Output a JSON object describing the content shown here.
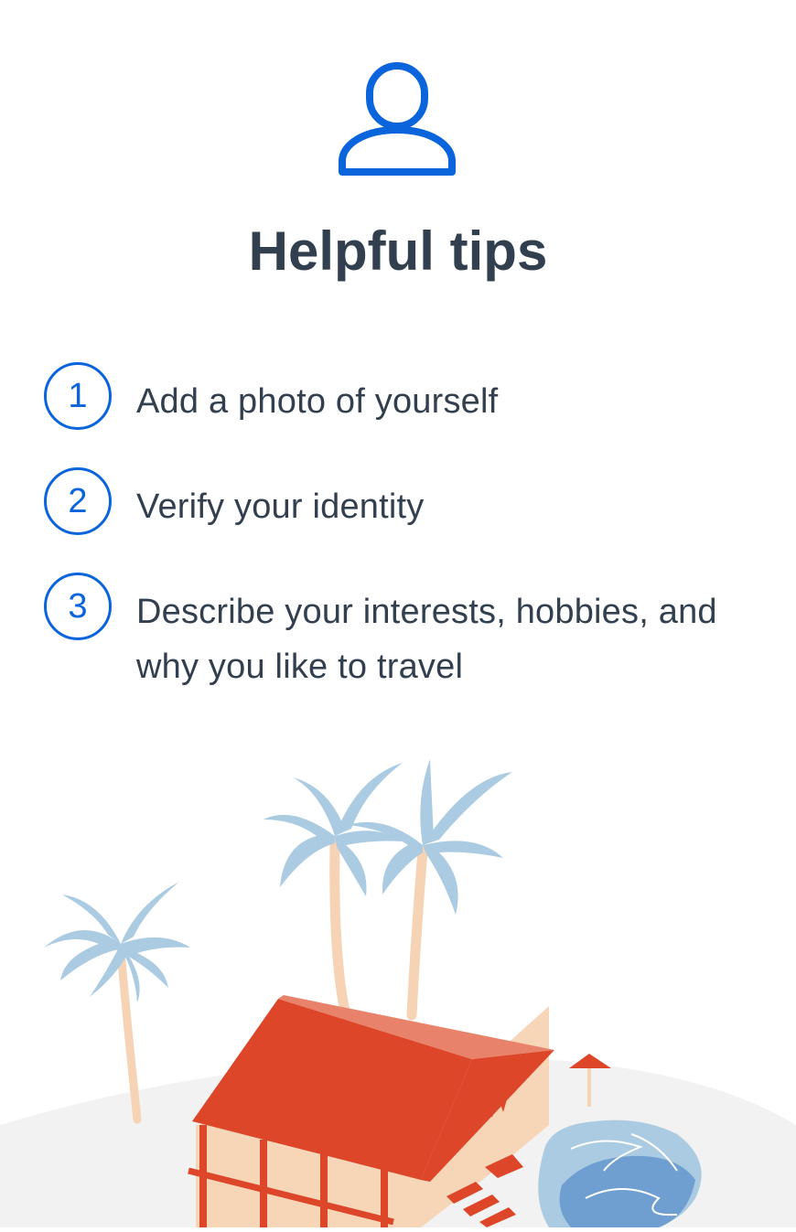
{
  "header": {
    "icon": "person-icon",
    "title": "Helpful tips"
  },
  "tips": [
    {
      "number": "1",
      "text": "Add a photo of yourself"
    },
    {
      "number": "2",
      "text": "Verify your identity"
    },
    {
      "number": "3",
      "text": "Describe your interests, hobbies, and why you like to travel"
    }
  ],
  "illustration": {
    "icon": "resort-illustration"
  },
  "colors": {
    "accent": "#0a64dc",
    "text": "#323f4e",
    "palm_leaves": "#abcbe2",
    "palm_trunks": "#f6d3b4",
    "roof": "#dd4629",
    "house_wall": "#f7d6b8",
    "pool": "#6f9fd1",
    "ground": "#f2f2f2"
  }
}
